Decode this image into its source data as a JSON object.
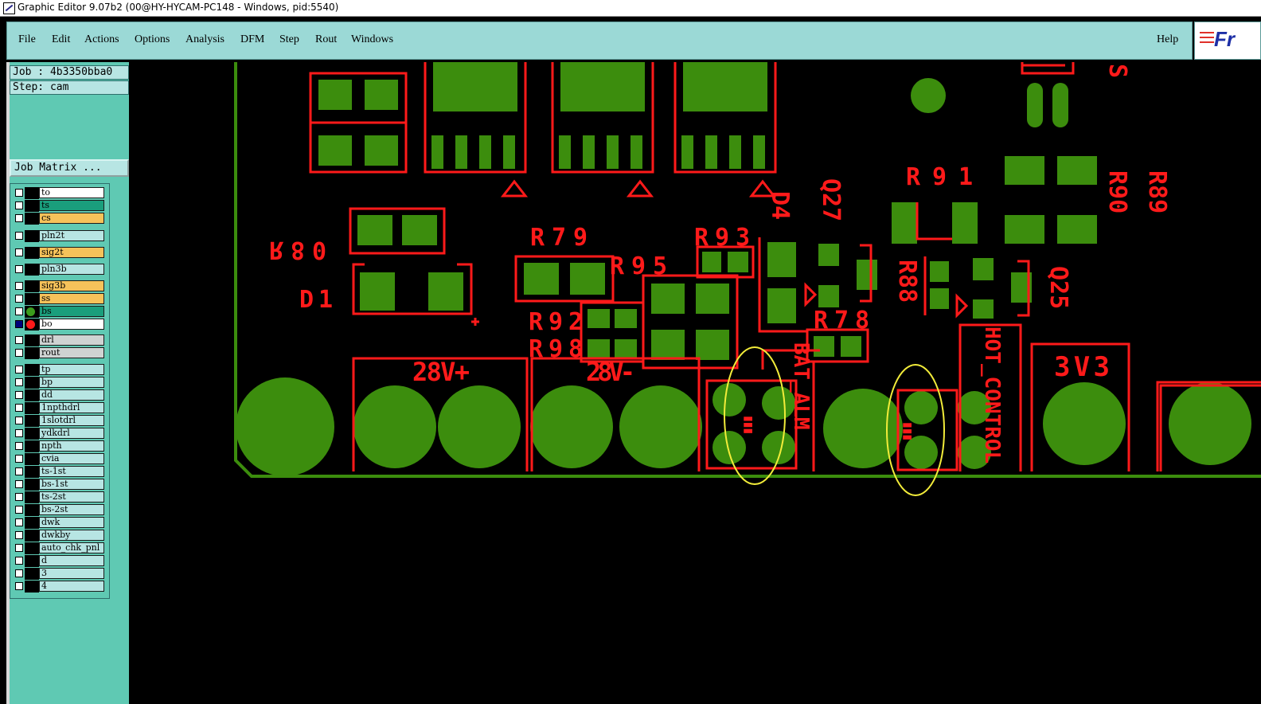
{
  "window": {
    "title": "Graphic Editor 9.07b2 (00@HY-HYCAM-PC148 - Windows, pid:5540)"
  },
  "menu": {
    "items": [
      {
        "label": "File"
      },
      {
        "label": "Edit"
      },
      {
        "label": "Actions"
      },
      {
        "label": "Options"
      },
      {
        "label": "Analysis"
      },
      {
        "label": "DFM"
      },
      {
        "label": "Step"
      },
      {
        "label": "Rout"
      },
      {
        "label": "Windows"
      }
    ],
    "help": "Help"
  },
  "logo": {
    "text": "Fr"
  },
  "job": {
    "job_label": "Job : 4b3350bba0",
    "step_label": "Step: cam",
    "matrix_button": "Job Matrix ..."
  },
  "layers": [
    {
      "name": "to",
      "color": "#ffffff",
      "checked": false
    },
    {
      "name": "ts",
      "color": "#1a9e7c",
      "checked": false
    },
    {
      "name": "cs",
      "color": "#f6c25a",
      "checked": false
    },
    {
      "name": "pln2t",
      "color": "#b7e5e3",
      "checked": false
    },
    {
      "name": "sig2t",
      "color": "#f6c25a",
      "checked": false
    },
    {
      "name": "pln3b",
      "color": "#b7e5e3",
      "checked": false
    },
    {
      "name": "sig3b",
      "color": "#f6c25a",
      "checked": false
    },
    {
      "name": "ss",
      "color": "#f6c25a",
      "checked": false
    },
    {
      "name": "bs",
      "color": "#1a9e7c",
      "checked": false,
      "dot": "#3c9d1d"
    },
    {
      "name": "bo",
      "color": "#ffffff",
      "checked": true,
      "dot": "#ff1a1a"
    },
    {
      "name": "drl",
      "color": "#cfd3d2",
      "checked": false
    },
    {
      "name": "rout",
      "color": "#cfd3d2",
      "checked": false
    },
    {
      "name": "tp",
      "color": "#b7e5e3",
      "checked": false
    },
    {
      "name": "bp",
      "color": "#b7e5e3",
      "checked": false
    },
    {
      "name": "dd",
      "color": "#b7e5e3",
      "checked": false
    },
    {
      "name": "1npthdrl",
      "color": "#b7e5e3",
      "checked": false
    },
    {
      "name": "1slotdrl",
      "color": "#b7e5e3",
      "checked": false
    },
    {
      "name": "ydkdrl",
      "color": "#b7e5e3",
      "checked": false
    },
    {
      "name": "npth",
      "color": "#b7e5e3",
      "checked": false
    },
    {
      "name": "cvia",
      "color": "#b7e5e3",
      "checked": false
    },
    {
      "name": "ts-1st",
      "color": "#b7e5e3",
      "checked": false
    },
    {
      "name": "bs-1st",
      "color": "#b7e5e3",
      "checked": false
    },
    {
      "name": "ts-2st",
      "color": "#b7e5e3",
      "checked": false
    },
    {
      "name": "bs-2st",
      "color": "#b7e5e3",
      "checked": false
    },
    {
      "name": "dwk",
      "color": "#b7e5e3",
      "checked": false
    },
    {
      "name": "dwkby",
      "color": "#b7e5e3",
      "checked": false
    },
    {
      "name": "auto_chk_pnl",
      "color": "#b7e5e3",
      "checked": false
    },
    {
      "name": "d",
      "color": "#b7e5e3",
      "checked": false
    },
    {
      "name": "3",
      "color": "#b7e5e3",
      "checked": false
    },
    {
      "name": "4",
      "color": "#b7e5e3",
      "checked": false
    }
  ],
  "pcb": {
    "silkscreen_labels": [
      "R80",
      "D1",
      "R79",
      "R93",
      "R95",
      "R92",
      "R98",
      "R91",
      "D4",
      "Q27",
      "R78",
      "R88",
      "Q25",
      "R90",
      "R89",
      "28V+",
      "28V-",
      "3V3",
      "BAT_ALM",
      "HOT_CONTROL"
    ],
    "colors": {
      "copper": "#3c8d0d",
      "silk": "#ff1a1a",
      "highlight": "#f2ec3a",
      "board_edge": "#3c8d0d"
    }
  }
}
